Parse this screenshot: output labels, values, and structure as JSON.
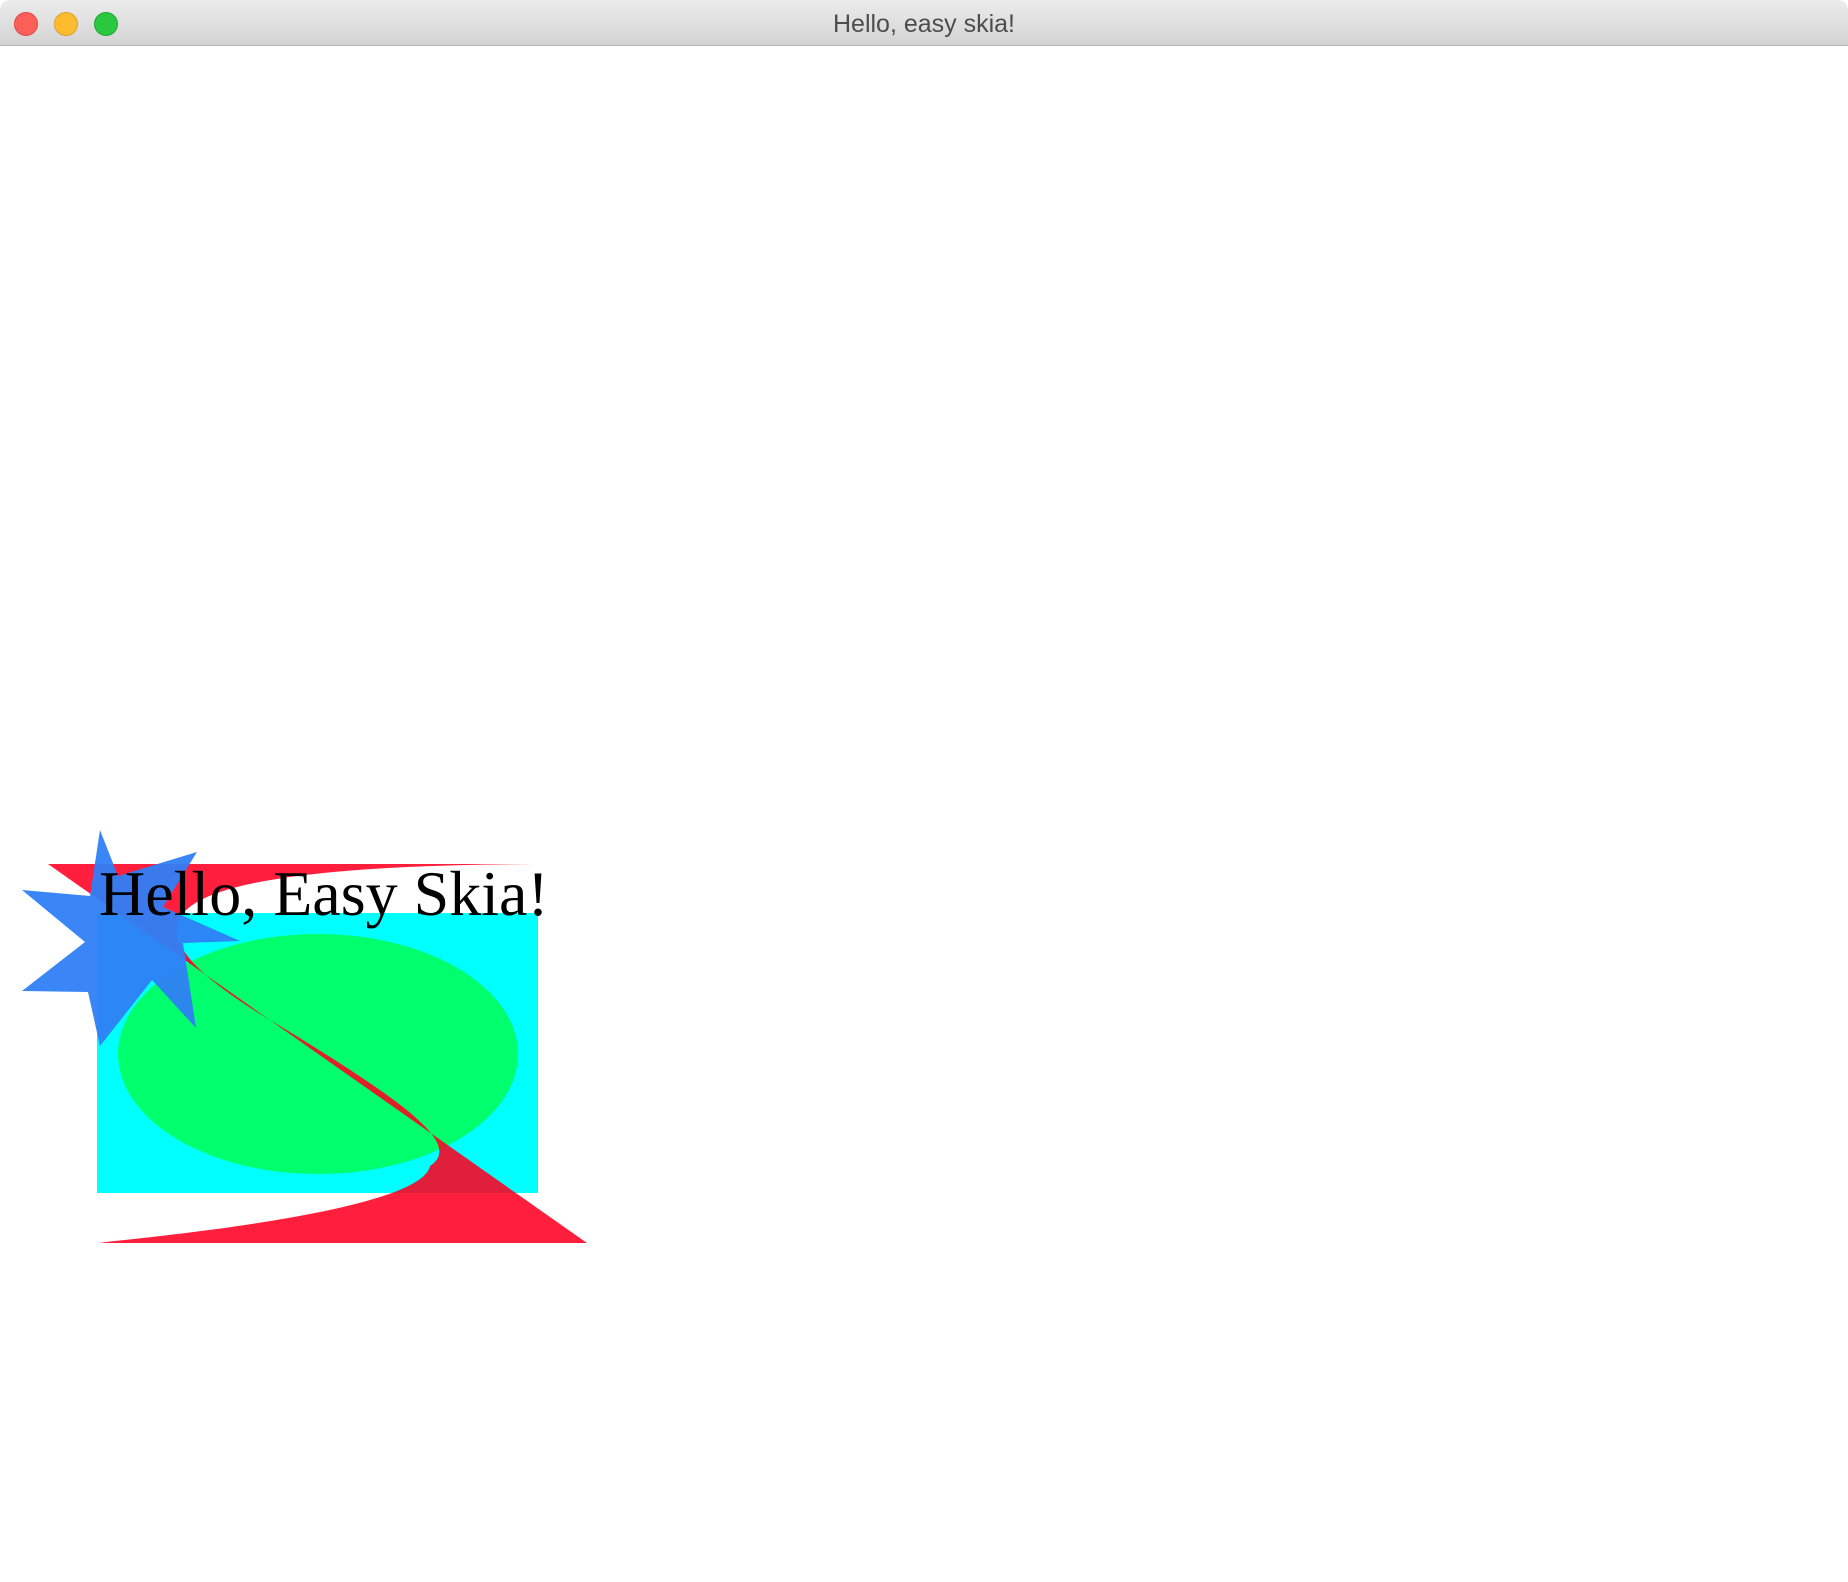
{
  "window": {
    "title": "Hello, easy skia!"
  },
  "canvas": {
    "text": "Hello, Easy Skia!",
    "colors": {
      "background": "#ffffff",
      "rect": "#00ffff",
      "oval": "#00ff6c",
      "star": "#2f7ff5",
      "curve": "#ff0022",
      "text": "#000000"
    }
  },
  "icons": {
    "close": "close-icon",
    "minimize": "minimize-icon",
    "zoom": "zoom-icon"
  }
}
